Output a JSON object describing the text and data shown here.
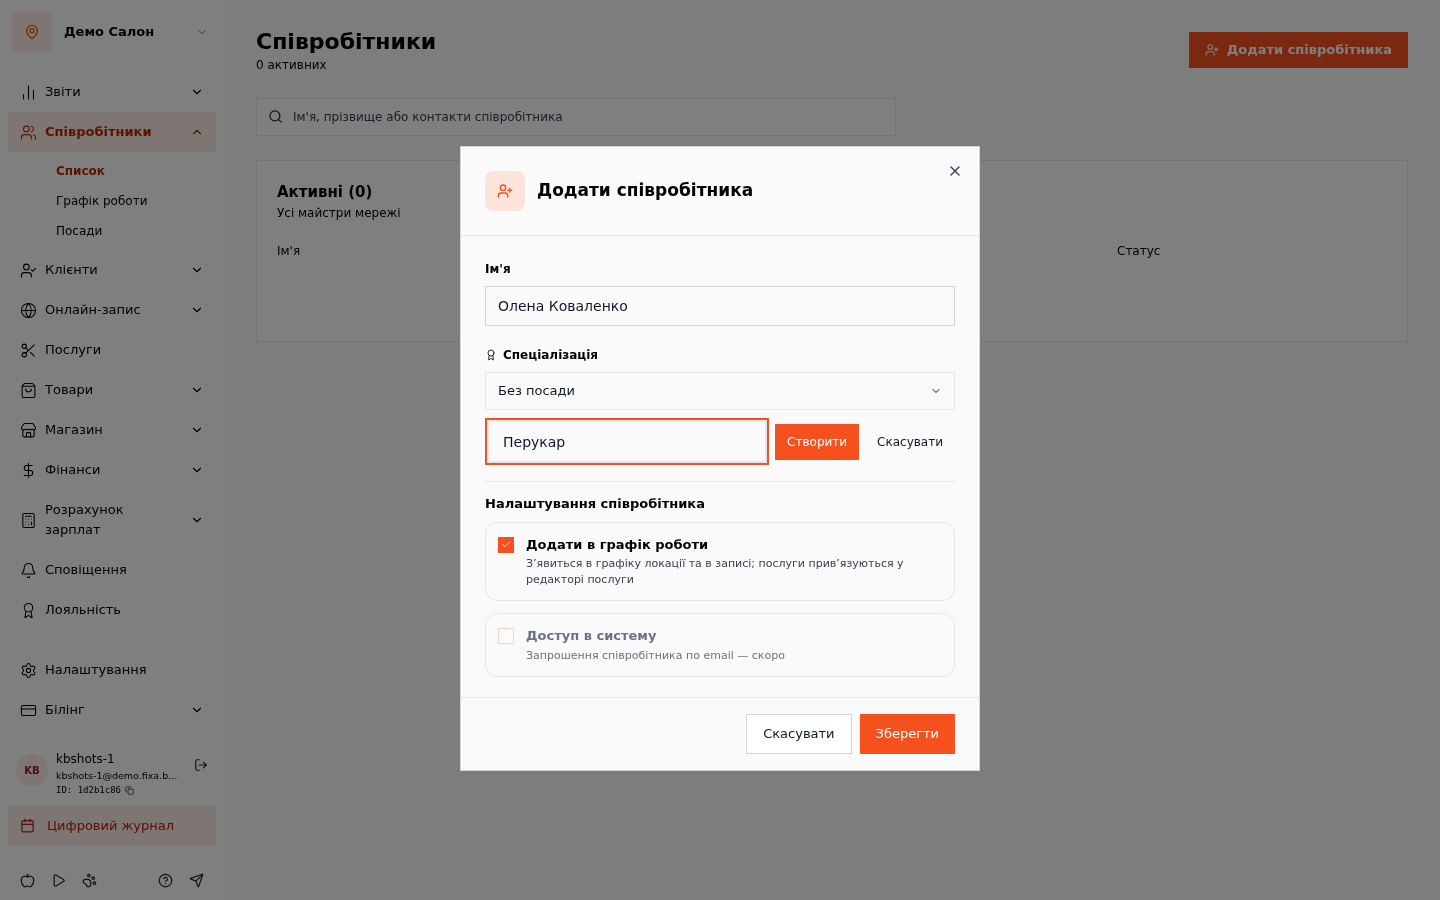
{
  "sidebar": {
    "location": "Демо Салон",
    "items": [
      {
        "label": "Звіти",
        "has_submenu": true,
        "expanded": false,
        "selected": false
      },
      {
        "label": "Співробітники",
        "has_submenu": true,
        "expanded": true,
        "selected": true,
        "children": [
          {
            "label": "Список",
            "selected": true
          },
          {
            "label": "Графік роботи",
            "selected": false
          },
          {
            "label": "Посади",
            "selected": false
          }
        ]
      },
      {
        "label": "Клієнти",
        "has_submenu": true,
        "expanded": false,
        "selected": false
      },
      {
        "label": "Онлайн-запис",
        "has_submenu": true,
        "expanded": false,
        "selected": false
      },
      {
        "label": "Послуги",
        "has_submenu": false,
        "selected": false
      },
      {
        "label": "Товари",
        "has_submenu": true,
        "expanded": false,
        "selected": false
      },
      {
        "label": "Магазин",
        "has_submenu": true,
        "expanded": false,
        "selected": false
      },
      {
        "label": "Фінанси",
        "has_submenu": true,
        "expanded": false,
        "selected": false
      },
      {
        "label": "Розрахунок зарплат",
        "has_submenu": true,
        "expanded": false,
        "selected": false
      },
      {
        "label": "Сповіщення",
        "has_submenu": false,
        "selected": false
      },
      {
        "label": "Лояльність",
        "has_submenu": false,
        "selected": false
      }
    ],
    "lower_items": [
      {
        "label": "Налаштування",
        "has_submenu": false,
        "selected": false
      },
      {
        "label": "Білінг",
        "has_submenu": true,
        "expanded": false,
        "selected": false
      }
    ],
    "user": {
      "initials": "KB",
      "name": "kbshots-1",
      "email": "kbshots-1@demo.fixa.b...",
      "id": "ID: 1d2b1c86"
    },
    "journal_button": "Цифровий журнал"
  },
  "main": {
    "title": "Співробітники",
    "subtitle": "0 активних",
    "add_button": "Додати співробітника",
    "search": {
      "placeholder": "Ім'я, прізвище або контакти співробітника"
    },
    "card": {
      "title": "Активні (0)",
      "subtitle": "Усі майстри мережі",
      "columns": [
        "Ім'я",
        "Статус"
      ]
    }
  },
  "modal": {
    "title": "Додати співробітника",
    "name_label": "Ім'я",
    "name_value": "Олена Коваленко",
    "spec_label": "Спеціалізація",
    "spec_value": "Без посади",
    "new_position": {
      "value": "Перукар",
      "focused": true,
      "create_button": "Створити",
      "cancel_button": "Скасувати"
    },
    "settings_title": "Налаштування співробітника",
    "options": [
      {
        "title": "Додати в графік роботи",
        "description": "З’явиться в графіку локації та в записі; послуги прив’язуються у редакторі послуги",
        "checked": true,
        "disabled": false
      },
      {
        "title": "Доступ в систему",
        "description": "Запрошення співробітника по email — скоро",
        "checked": false,
        "disabled": true
      }
    ],
    "cancel_button": "Скасувати",
    "save_button": "Зберегти"
  }
}
